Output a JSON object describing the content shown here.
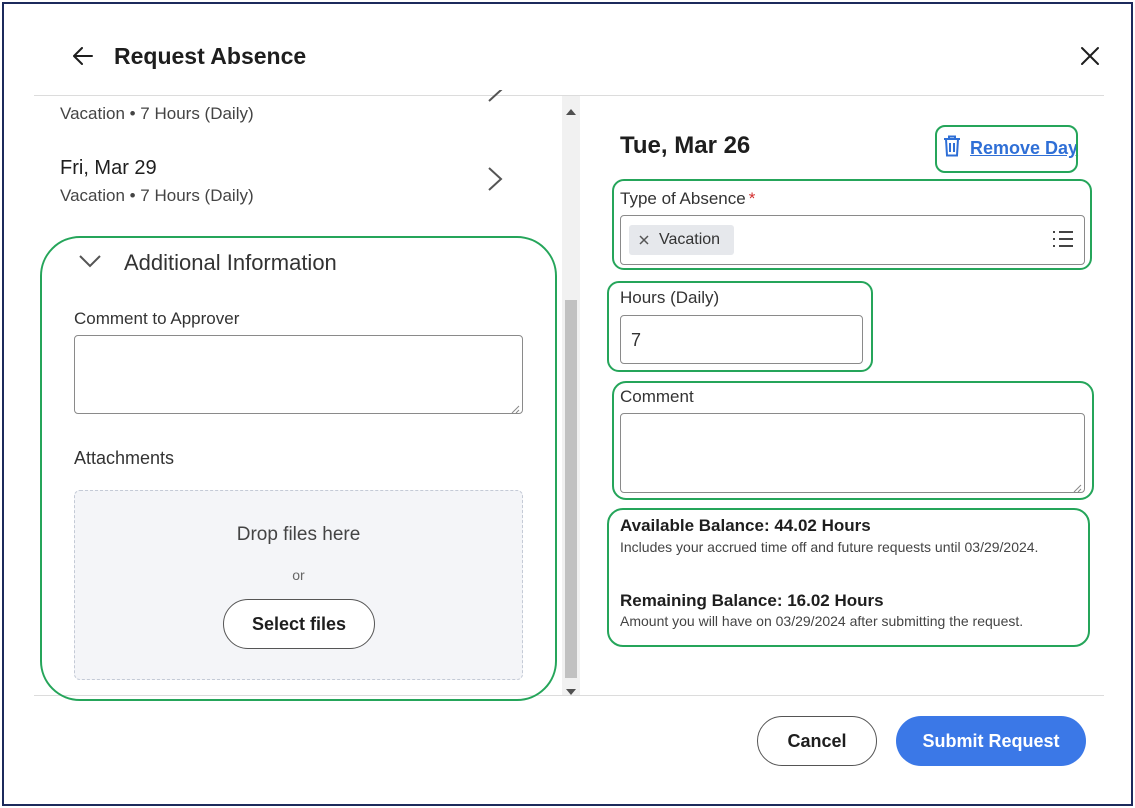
{
  "header": {
    "title": "Request Absence"
  },
  "left": {
    "days": [
      {
        "date": "",
        "detail": "Vacation • 7 Hours (Daily)"
      },
      {
        "date": "Fri, Mar 29",
        "detail": "Vacation • 7 Hours (Daily)"
      }
    ],
    "additional": {
      "title": "Additional Information",
      "comment_label": "Comment to Approver",
      "attachments_label": "Attachments",
      "drop_text": "Drop files here",
      "or_text": "or",
      "select_files": "Select files"
    }
  },
  "right": {
    "date": "Tue, Mar 26",
    "remove_day": "Remove Day",
    "type_label": "Type of Absence",
    "required_mark": "*",
    "type_value": "Vacation",
    "hours_label": "Hours (Daily)",
    "hours_value": "7",
    "comment_label": "Comment",
    "available_title": "Available Balance: 44.02 Hours",
    "available_desc": "Includes your accrued time off and future requests until 03/29/2024.",
    "remaining_title": "Remaining Balance: 16.02 Hours",
    "remaining_desc": "Amount you will have on 03/29/2024 after submitting the request."
  },
  "footer": {
    "cancel": "Cancel",
    "submit": "Submit Request"
  },
  "colors": {
    "accent": "#3b78e7",
    "link": "#2f6fd6",
    "highlight": "#25a55a",
    "required": "#d32f2f"
  }
}
